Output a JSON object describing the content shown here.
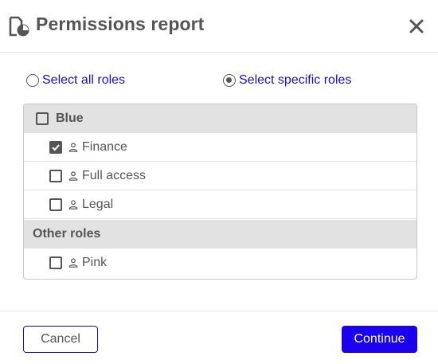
{
  "dialog": {
    "title": "Permissions report",
    "icons": {
      "header": "document-chart-icon",
      "close": "close-icon"
    }
  },
  "scope": {
    "options": [
      {
        "label": "Select all roles",
        "selected": false
      },
      {
        "label": "Select specific roles",
        "selected": true
      }
    ]
  },
  "roles": {
    "groups": [
      {
        "label": "Blue",
        "checked": false,
        "items": [
          {
            "label": "Finance",
            "checked": true
          },
          {
            "label": "Full access",
            "checked": false
          },
          {
            "label": "Legal",
            "checked": false
          }
        ]
      },
      {
        "label": "Other roles",
        "items": [
          {
            "label": "Pink",
            "checked": false
          }
        ]
      }
    ],
    "item_icon": "person-icon"
  },
  "footer": {
    "cancel_label": "Cancel",
    "continue_label": "Continue"
  },
  "colors": {
    "accent": "#1a00ee",
    "link": "#1a0dcc",
    "text": "#555555",
    "group_bg": "#e2e2e2"
  }
}
